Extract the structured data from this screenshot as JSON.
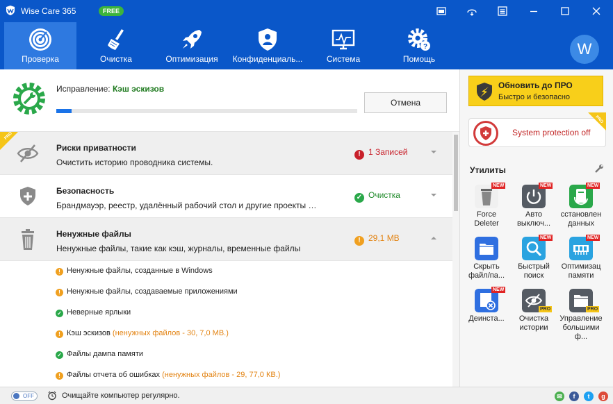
{
  "titlebar": {
    "app_title": "Wise Care 365",
    "free_badge": "FREE"
  },
  "nav": {
    "items": [
      {
        "label": "Проверка",
        "icon": "radar-icon",
        "active": true
      },
      {
        "label": "Очистка",
        "icon": "broom-icon"
      },
      {
        "label": "Оптимизация",
        "icon": "rocket-icon"
      },
      {
        "label": "Конфиденциаль...",
        "icon": "privacy-shield-icon"
      },
      {
        "label": "Система",
        "icon": "monitor-icon"
      },
      {
        "label": "Помощь",
        "icon": "help-gear-icon"
      }
    ],
    "avatar_letter": "W"
  },
  "scan": {
    "fix_prefix": "Исправление:",
    "fix_value": "Кэш эскизов",
    "progress": 0.05,
    "cancel_label": "Отмена"
  },
  "categories": [
    {
      "title": "Риски приватности",
      "desc": "Очистить историю проводника системы.",
      "status": "1 Записей",
      "status_type": "error",
      "status_color": "#c8202a",
      "pro": true,
      "expanded": false
    },
    {
      "title": "Безопасность",
      "desc": "Брандмауэр, реестр, удалённый рабочий стол и другие проекты безоп...",
      "status": "Очистка",
      "status_type": "ok",
      "status_color": "#1f8a2a",
      "pro": false,
      "expanded": false
    },
    {
      "title": "Ненужные файлы",
      "desc": "Ненужные файлы, такие как кэш, журналы, временные файлы",
      "status": "29,1 MB",
      "status_type": "warn",
      "status_color": "#e38414",
      "pro": false,
      "expanded": true
    }
  ],
  "junk_items": [
    {
      "label": "Ненужные файлы, созданные в Windows",
      "extra": "",
      "state": "warn"
    },
    {
      "label": "Ненужные файлы, создаваемые приложениями",
      "extra": "",
      "state": "warn"
    },
    {
      "label": "Неверные ярлыки",
      "extra": "",
      "state": "ok"
    },
    {
      "label": "Кэш эскизов",
      "extra": "(ненужных файлов - 30, 7,0 МВ.)",
      "state": "warn"
    },
    {
      "label": "Файлы дампа памяти",
      "extra": "",
      "state": "ok"
    },
    {
      "label": "Файлы отчета об ошибках",
      "extra": "(ненужных файлов - 29, 77,0 КВ.)",
      "state": "warn"
    }
  ],
  "upgrade": {
    "title": "Обновить до ПРО",
    "subtitle": "Быстро и безопасно",
    "pro_ribbon": "PRO"
  },
  "protection": {
    "label": "System protection off",
    "pro_ribbon": "PRO"
  },
  "utilities": {
    "title": "Утилиты",
    "tools": [
      {
        "label": "Force\nDeleter",
        "icon": "trash-can-icon",
        "badge": "NEW",
        "color": "#e8e8e8"
      },
      {
        "label": "Авто\nвыключ...",
        "icon": "power-icon",
        "badge": "NEW",
        "color": "#555b63"
      },
      {
        "label": "сстановлен\nданных",
        "icon": "data-recovery-icon",
        "badge": "NEW",
        "color": "#2aa84a"
      },
      {
        "label": "Скрыть\nфайл/па...",
        "icon": "hide-folder-icon",
        "badge": "",
        "color": "#2f6fe0"
      },
      {
        "label": "Быстрый\nпоиск",
        "icon": "search-icon",
        "badge": "NEW",
        "color": "#2aa3e0"
      },
      {
        "label": "Оптимизац\nпамяти",
        "icon": "memory-icon",
        "badge": "NEW",
        "color": "#2aa3e0"
      },
      {
        "label": "Деинста...",
        "icon": "uninstall-icon",
        "badge": "NEW",
        "color": "#2f6fe0"
      },
      {
        "label": "Очистка\nистории",
        "icon": "history-eye-icon",
        "badge": "PRO",
        "color": "#555b63"
      },
      {
        "label": "Управление\nбольшими\nф...",
        "icon": "large-files-folder-icon",
        "badge": "PRO",
        "color": "#555b63"
      }
    ]
  },
  "statusbar": {
    "toggle_label": "OFF",
    "text": "Очищайте компьютер регулярно."
  }
}
